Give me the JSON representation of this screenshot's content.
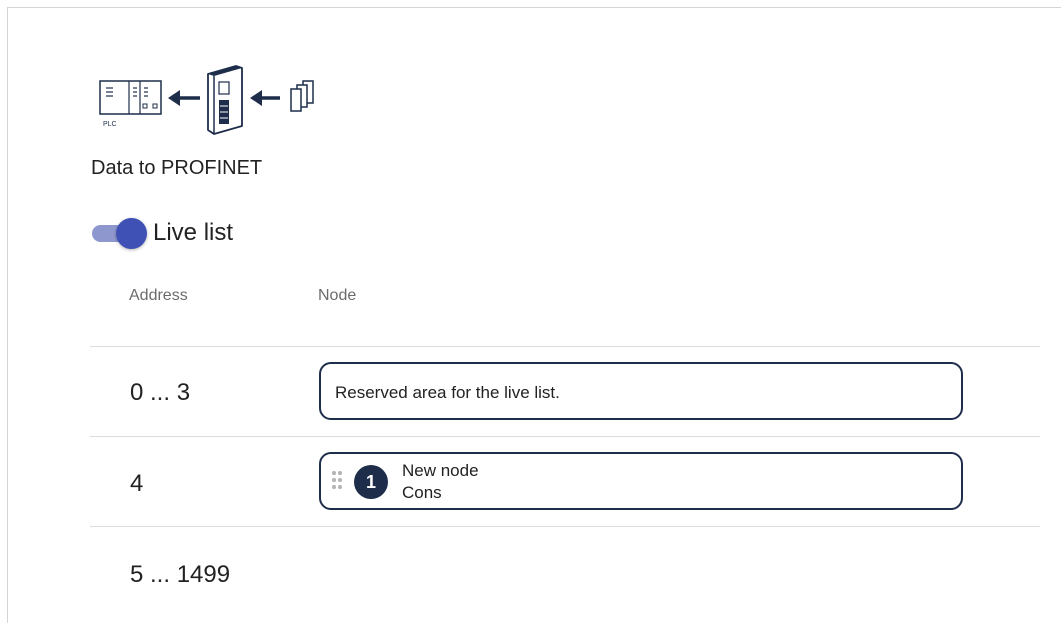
{
  "diagram": {
    "plc_label": "PLC"
  },
  "section": {
    "title": "Data to PROFINET"
  },
  "live_list": {
    "label": "Live list",
    "enabled": true
  },
  "table": {
    "columns": {
      "address": "Address",
      "node": "Node"
    },
    "rows": [
      {
        "address": "0 ... 3",
        "node_text": "Reserved area for the live list."
      },
      {
        "address": "4",
        "node": {
          "number": "1",
          "name": "New node",
          "type": "Cons"
        }
      },
      {
        "address": "5 ... 1499"
      }
    ]
  },
  "colors": {
    "accent": "#3f51b5",
    "node_border": "#1d2d4a"
  }
}
